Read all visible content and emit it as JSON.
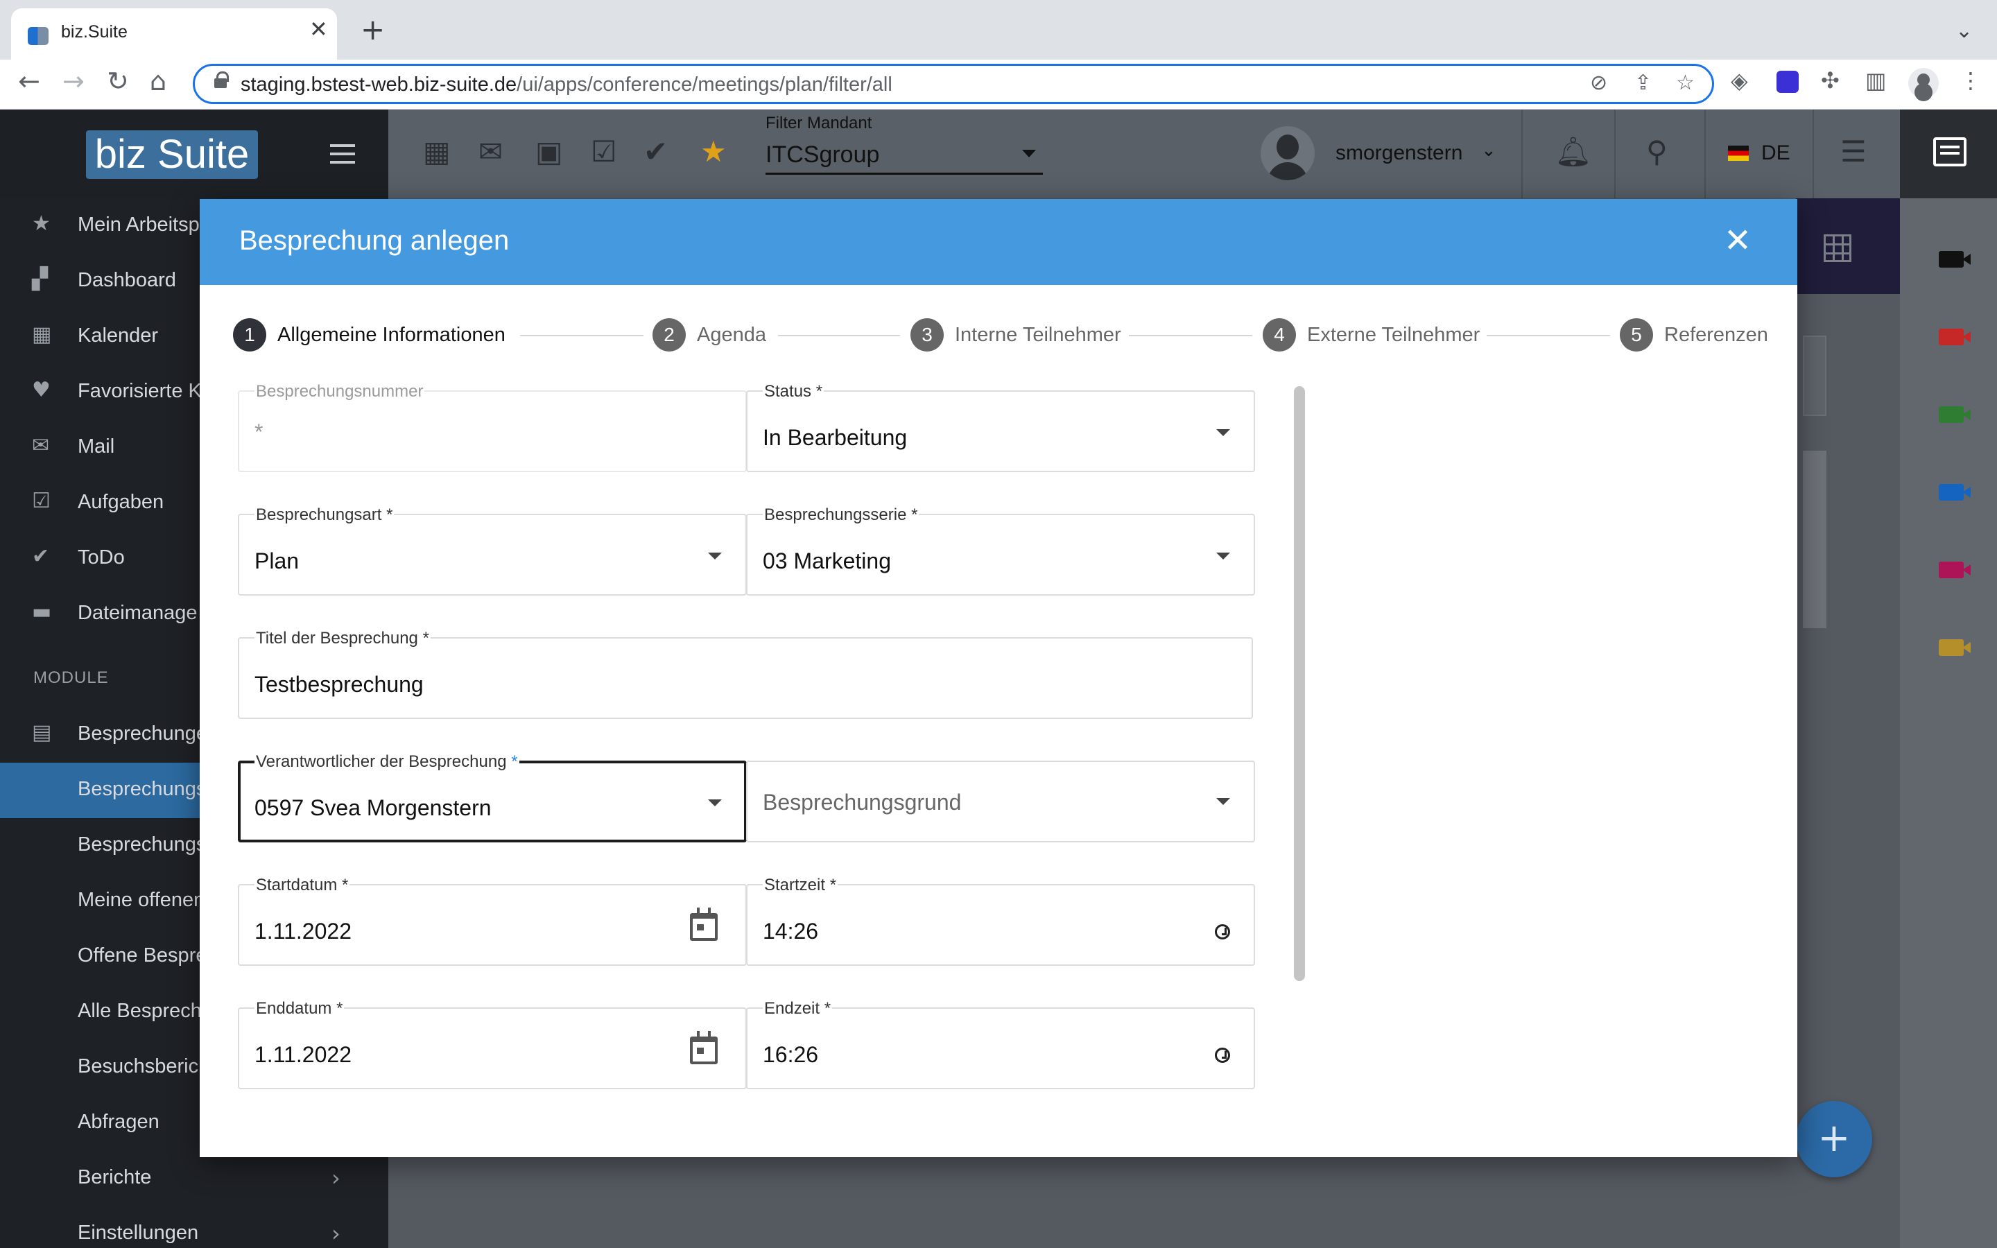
{
  "browser": {
    "tab_title": "biz.Suite",
    "url_host": "staging.bstest-web.biz-suite.de",
    "url_path": "/ui/apps/conference/meetings/plan/filter/all"
  },
  "header": {
    "logo_text": "biz Suite",
    "filter_label": "Filter Mandant",
    "filter_value": "ITCSgroup",
    "username": "smorgenstern",
    "language": "DE"
  },
  "sidebar": {
    "items": [
      {
        "label": "Mein Arbeitsp",
        "icon": "star-icon"
      },
      {
        "label": "Dashboard",
        "icon": "dashboard-icon"
      },
      {
        "label": "Kalender",
        "icon": "calendar-icon"
      },
      {
        "label": "Favorisierte K",
        "icon": "heart-icon"
      },
      {
        "label": "Mail",
        "icon": "mail-icon"
      },
      {
        "label": "Aufgaben",
        "icon": "checkbox-icon"
      },
      {
        "label": "ToDo",
        "icon": "check-icon"
      },
      {
        "label": "Dateimanage",
        "icon": "folder-icon"
      }
    ],
    "module_title": "MODULE",
    "module_items": [
      {
        "label": "Besprechunge",
        "icon": "clipboard-icon"
      },
      {
        "label": "Besprechungs",
        "active": true
      },
      {
        "label": "Besprechungs"
      },
      {
        "label": "Meine offenen"
      },
      {
        "label": "Offene Bespre"
      },
      {
        "label": "Alle Besprech"
      },
      {
        "label": "Besuchsberich"
      },
      {
        "label": "Abfragen"
      },
      {
        "label": "Berichte"
      },
      {
        "label": "Einstellungen"
      }
    ]
  },
  "modal": {
    "title": "Besprechung anlegen",
    "steps": [
      {
        "num": "1",
        "label": "Allgemeine Informationen"
      },
      {
        "num": "2",
        "label": "Agenda"
      },
      {
        "num": "3",
        "label": "Interne Teilnehmer"
      },
      {
        "num": "4",
        "label": "Externe Teilnehmer"
      },
      {
        "num": "5",
        "label": "Referenzen"
      }
    ],
    "fields": {
      "nummer": {
        "label": "Besprechungsnummer",
        "value": "*"
      },
      "status": {
        "label": "Status *",
        "value": "In Bearbeitung"
      },
      "art": {
        "label": "Besprechungsart *",
        "value": "Plan"
      },
      "serie": {
        "label": "Besprechungsserie *",
        "value": "03 Marketing"
      },
      "titel": {
        "label": "Titel der Besprechung *",
        "value": "Testbesprechung"
      },
      "verantwortlicher": {
        "label": "Verantwortlicher der Besprechung",
        "required_mark": "*",
        "value": "0597 Svea Morgenstern"
      },
      "grund": {
        "placeholder": "Besprechungsgrund"
      },
      "startdatum": {
        "label": "Startdatum *",
        "value": "1.11.2022"
      },
      "startzeit": {
        "label": "Startzeit *",
        "value": "14:26"
      },
      "enddatum": {
        "label": "Enddatum *",
        "value": "1.11.2022"
      },
      "endzeit": {
        "label": "Endzeit *",
        "value": "16:26"
      }
    }
  },
  "colors": {
    "modal_header": "#4599df",
    "sidebar_active": "#2c6aa0",
    "sidebar_bg": "#1e2126",
    "fab": "#2b6aa6"
  }
}
